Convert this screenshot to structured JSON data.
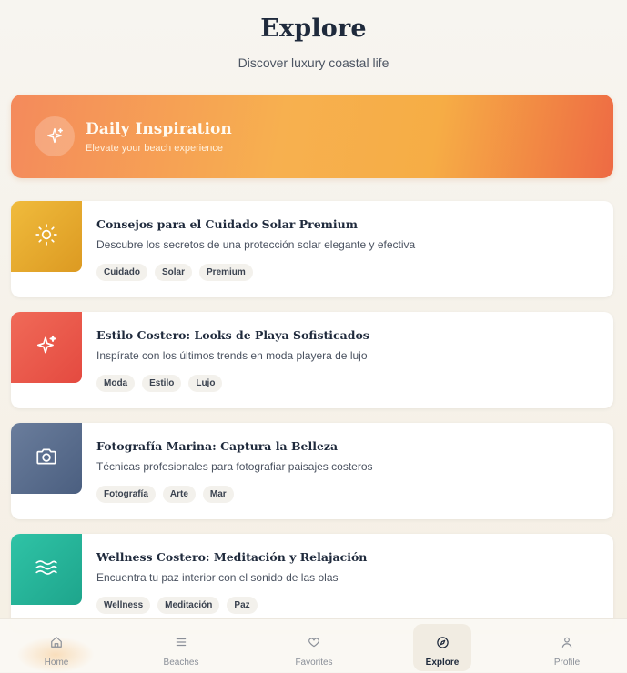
{
  "header": {
    "title": "Explore",
    "subtitle": "Discover luxury coastal life"
  },
  "hero": {
    "title": "Daily Inspiration",
    "subtitle": "Elevate your beach experience",
    "icon": "sparkles-icon"
  },
  "cards": [
    {
      "title": "Consejos para el Cuidado Solar Premium",
      "description": "Descubre los secretos de una protección solar elegante y efectiva",
      "tags": [
        "Cuidado",
        "Solar",
        "Premium"
      ],
      "icon": "sun-icon",
      "color": "#e8aa2e"
    },
    {
      "title": "Estilo Costero: Looks de Playa Sofisticados",
      "description": "Inspírate con los últimos trends en moda playera de lujo",
      "tags": [
        "Moda",
        "Estilo",
        "Lujo"
      ],
      "icon": "sparkles-icon",
      "color": "#ec5a4c"
    },
    {
      "title": "Fotografía Marina: Captura la Belleza",
      "description": "Técnicas profesionales para fotografiar paisajes costeros",
      "tags": [
        "Fotografía",
        "Arte",
        "Mar"
      ],
      "icon": "camera-icon",
      "color": "#5b6f8f"
    },
    {
      "title": "Wellness Costero: Meditación y Relajación",
      "description": "Encuentra tu paz interior con el sonido de las olas",
      "tags": [
        "Wellness",
        "Meditación",
        "Paz"
      ],
      "icon": "waves-icon",
      "color": "#25b39a"
    }
  ],
  "nav": {
    "items": [
      {
        "label": "Home",
        "icon": "home-icon"
      },
      {
        "label": "Beaches",
        "icon": "list-icon"
      },
      {
        "label": "Favorites",
        "icon": "heart-icon"
      },
      {
        "label": "Explore",
        "icon": "compass-icon"
      },
      {
        "label": "Profile",
        "icon": "user-icon"
      }
    ],
    "active": "Explore"
  }
}
